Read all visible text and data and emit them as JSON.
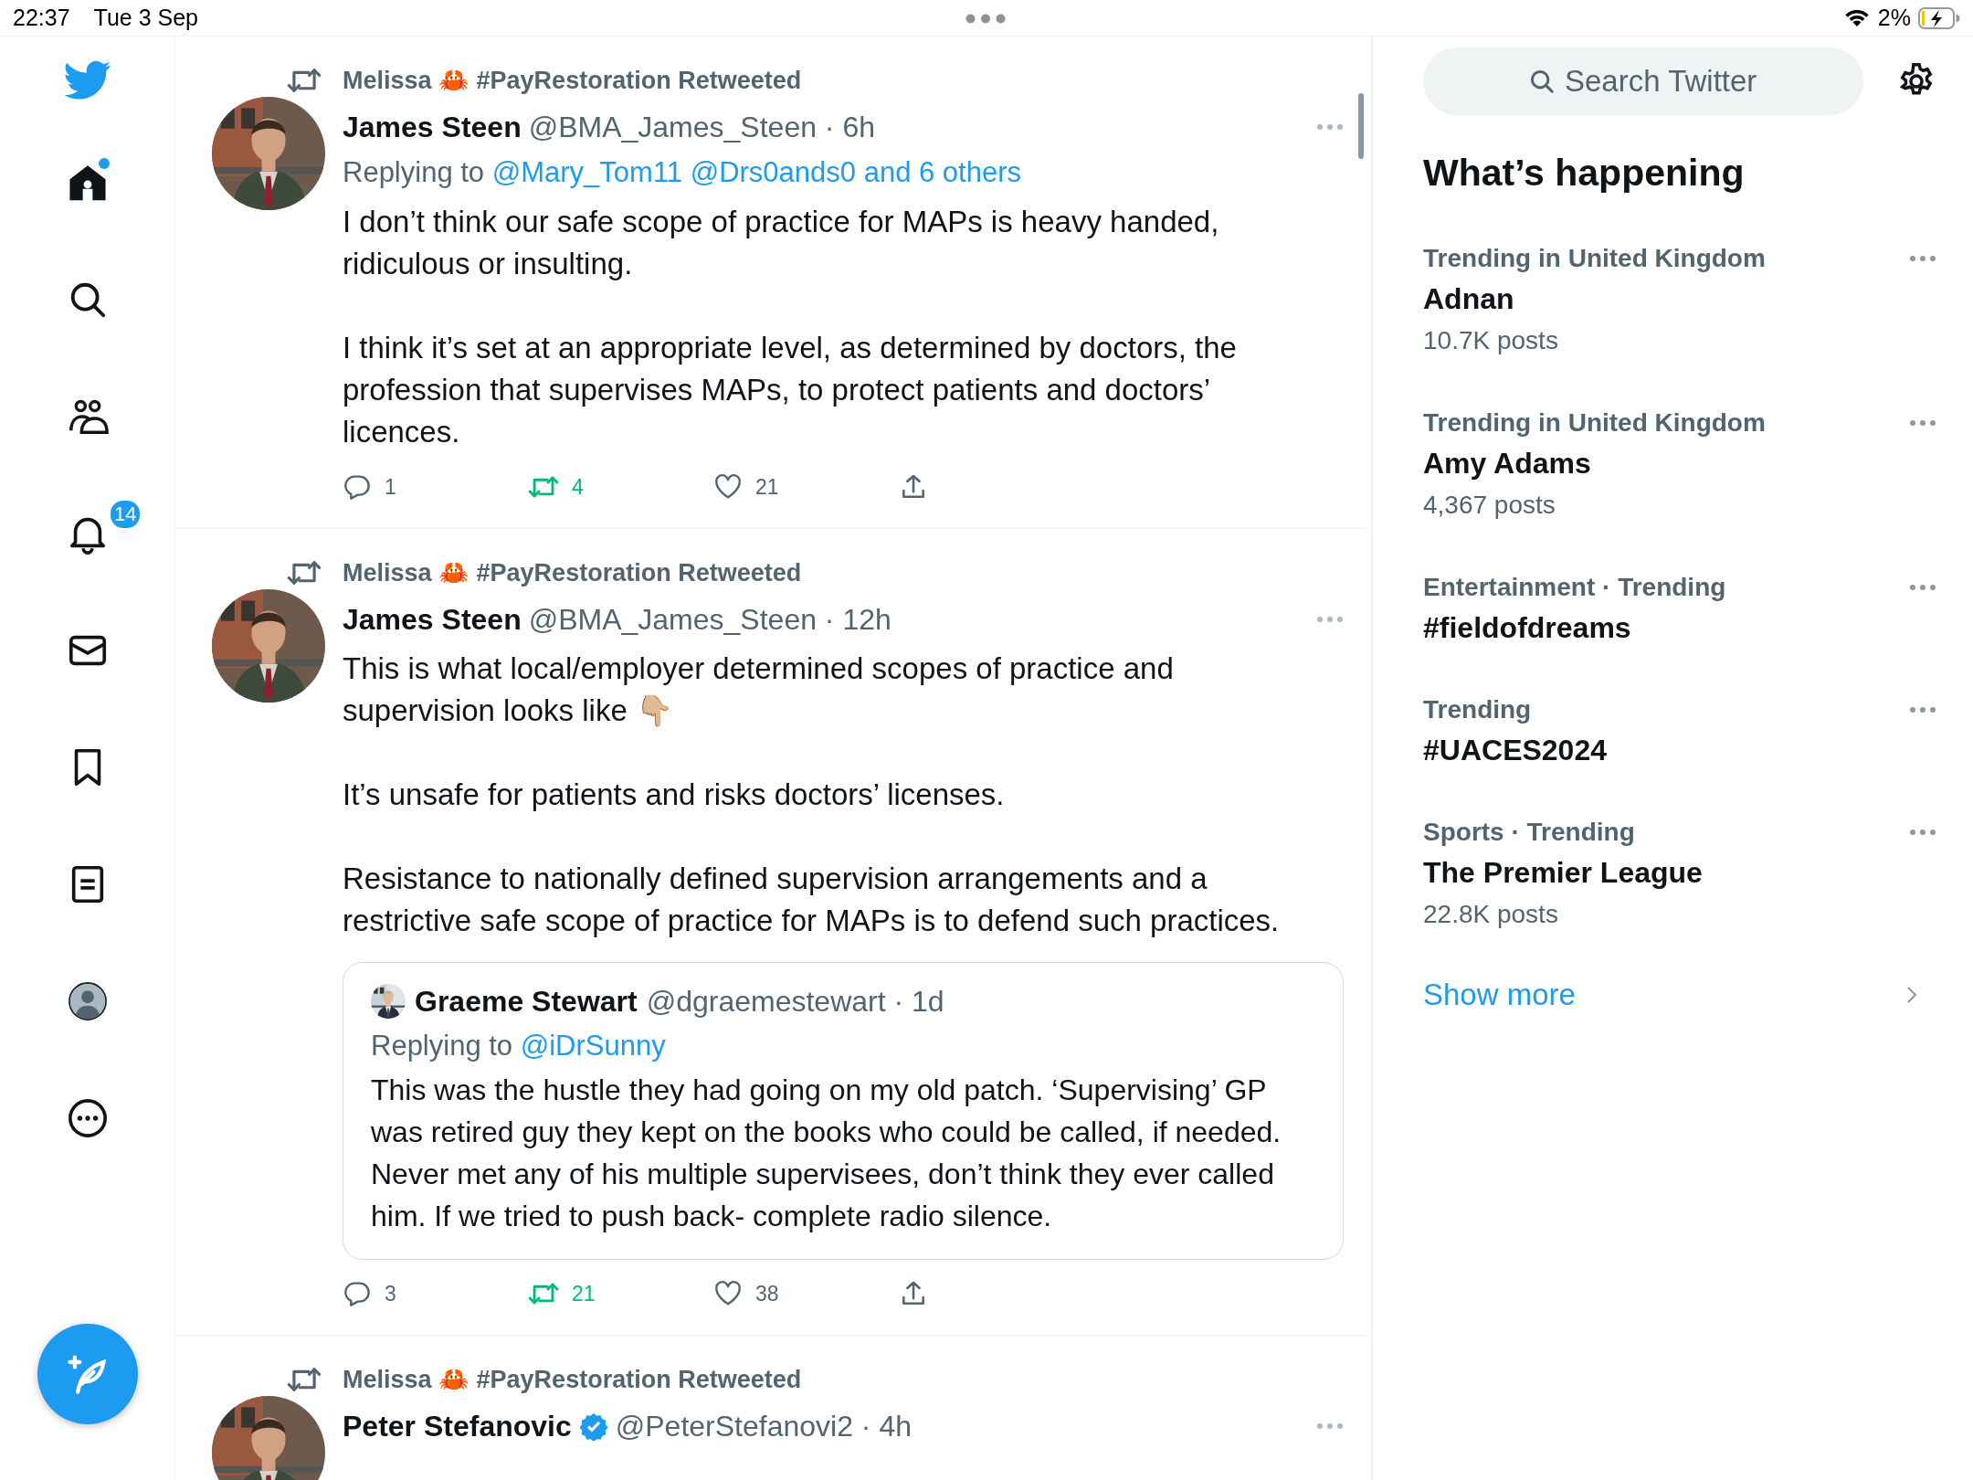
{
  "status_bar": {
    "time": "22:37",
    "date": "Tue 3 Sep",
    "battery": "2%"
  },
  "nav": [
    {
      "kind": "home",
      "selected": true,
      "unread": true
    },
    {
      "kind": "search",
      "selected": false,
      "unread": false
    },
    {
      "kind": "communities",
      "selected": false,
      "unread": false
    },
    {
      "kind": "notifications",
      "selected": false,
      "unread": false,
      "badge": "14"
    },
    {
      "kind": "messages",
      "selected": false,
      "unread": false
    },
    {
      "kind": "bookmarks",
      "selected": false,
      "unread": false
    },
    {
      "kind": "lists",
      "selected": false,
      "unread": false
    },
    {
      "kind": "profile",
      "selected": false,
      "unread": false
    },
    {
      "kind": "more",
      "selected": false,
      "unread": false
    }
  ],
  "tweets": [
    {
      "retweeted_by": "Melissa 🦀 #PayRestoration Retweeted",
      "name": "James Steen",
      "verified": false,
      "meta": "@BMA_James_Steen · 6h",
      "replying_prefix": "Replying to",
      "replying_to": "@Mary_Tom11 @Drs0ands0 and 6 others",
      "paragraphs": [
        "I don’t think our safe scope of practice for MAPs is heavy handed, ridiculous or insulting.",
        "I think it’s set at an appropriate level, as determined by doctors, the profession that supervises MAPs, to protect patients and doctors’ licences."
      ],
      "actions": {
        "replies": "1",
        "retweets": "4",
        "likes": "21",
        "retweeted": true,
        "liked": false
      }
    },
    {
      "retweeted_by": "Melissa 🦀 #PayRestoration Retweeted",
      "name": "James Steen",
      "verified": false,
      "meta": "@BMA_James_Steen · 12h",
      "paragraphs": [
        "This is what local/employer determined scopes of practice and supervision looks like 👇🏼",
        "It’s unsafe for patients and risks doctors’ licenses.",
        "Resistance to nationally defined supervision arrangements and a restrictive safe scope of practice for MAPs is to defend such practices."
      ],
      "quote": {
        "name": "Graeme Stewart",
        "meta": "@dgraemestewart · 1d",
        "replying_prefix": "Replying to",
        "replying_to": "@iDrSunny",
        "text": "This was the hustle they had going on my old patch. ‘Supervising’ GP was retired guy they kept on the books who could be called, if needed. Never met any of his multiple supervisees, don’t think they ever called him. If we tried to push back- complete radio silence."
      },
      "actions": {
        "replies": "3",
        "retweets": "21",
        "likes": "38",
        "retweeted": true,
        "liked": false
      }
    },
    {
      "retweeted_by": "Melissa 🦀 #PayRestoration Retweeted",
      "name": "Peter Stefanovic",
      "verified": true,
      "meta": "@PeterStefanovi2 · 4h"
    }
  ],
  "search": {
    "placeholder": "Search Twitter"
  },
  "trends_title": "What’s happening",
  "trends": [
    {
      "context": "Trending in United Kingdom",
      "name": "Adnan",
      "count": "10.7K posts"
    },
    {
      "context": "Trending in United Kingdom",
      "name": "Amy Adams",
      "count": "4,367 posts"
    },
    {
      "context": "Entertainment · Trending",
      "name": "#fieldofdreams"
    },
    {
      "context": "Trending",
      "name": "#UACES2024"
    },
    {
      "context": "Sports · Trending",
      "name": "The Premier League",
      "count": "22.8K posts"
    }
  ],
  "show_more": "Show more"
}
